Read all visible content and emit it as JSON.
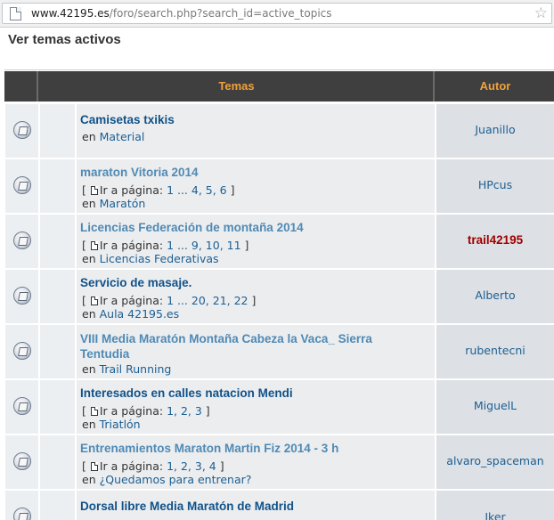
{
  "browser": {
    "url_host": "www.42195.es",
    "url_path": "/foro/search.php?search_id=active_topics"
  },
  "page": {
    "title": "Ver temas activos"
  },
  "table": {
    "headers": {
      "temas": "Temas",
      "autor": "Autor"
    },
    "rows": [
      {
        "title": "Camisetas txikis",
        "read": false,
        "pages": null,
        "pages_prefix": "[",
        "pages_label": "Ir a página:",
        "pages_suffix": "]",
        "forum_prefix": "en",
        "forum": "Material",
        "author": "Juanillo",
        "author_special": false
      },
      {
        "title": "maraton Vitoria 2014",
        "read": true,
        "pages_prefix": "[",
        "pages_label": "Ir a página:",
        "pages": "1 ... 4, 5, 6",
        "pages_suffix": "]",
        "forum_prefix": "en",
        "forum": "Maratón",
        "author": "HPcus",
        "author_special": false
      },
      {
        "title": "Licencias Federación de montaña 2014",
        "read": true,
        "pages_prefix": "[",
        "pages_label": "Ir a página:",
        "pages": "1 ... 9, 10, 11",
        "pages_suffix": "]",
        "forum_prefix": "en",
        "forum": "Licencias Federativas",
        "author": "trail42195",
        "author_special": true
      },
      {
        "title": "Servicio de masaje.",
        "read": false,
        "pages_prefix": "[",
        "pages_label": "Ir a página:",
        "pages": "1 ... 20, 21, 22",
        "pages_suffix": "]",
        "forum_prefix": "en",
        "forum": "Aula 42195.es",
        "author": "Alberto",
        "author_special": false
      },
      {
        "title": "VIII Media Maratón Montaña Cabeza la Vaca_ Sierra Tentudia",
        "read": true,
        "pages": null,
        "pages_prefix": "[",
        "pages_label": "Ir a página:",
        "pages_suffix": "]",
        "forum_prefix": "en",
        "forum": "Trail Running",
        "author": "rubentecni",
        "author_special": false
      },
      {
        "title": "Interesados en calles natacion Mendi",
        "read": false,
        "pages_prefix": "[",
        "pages_label": "Ir a página:",
        "pages": "1, 2, 3",
        "pages_suffix": "]",
        "forum_prefix": "en",
        "forum": "Triatlón",
        "author": "MiguelL",
        "author_special": false
      },
      {
        "title": "Entrenamientos Maraton Martin Fiz 2014 - 3 h",
        "read": true,
        "pages_prefix": "[",
        "pages_label": "Ir a página:",
        "pages": "1, 2, 3, 4",
        "pages_suffix": "]",
        "forum_prefix": "en",
        "forum": "¿Quedamos para entrenar?",
        "author": "alvaro_spaceman",
        "author_special": false
      },
      {
        "title": "Dorsal libre Media Maratón de Madrid",
        "read": false,
        "pages": null,
        "pages_prefix": "[",
        "pages_label": "Ir a página:",
        "pages_suffix": "]",
        "forum_prefix": "en",
        "forum": "",
        "author": "Iker",
        "author_special": false
      }
    ]
  },
  "colors": {
    "header_bg": "#3f3f3f",
    "header_text": "#f0a13b",
    "unread_title": "#105289",
    "read_title": "#4f8ab5",
    "link": "#1b5f93",
    "special_author": "#a00000"
  }
}
